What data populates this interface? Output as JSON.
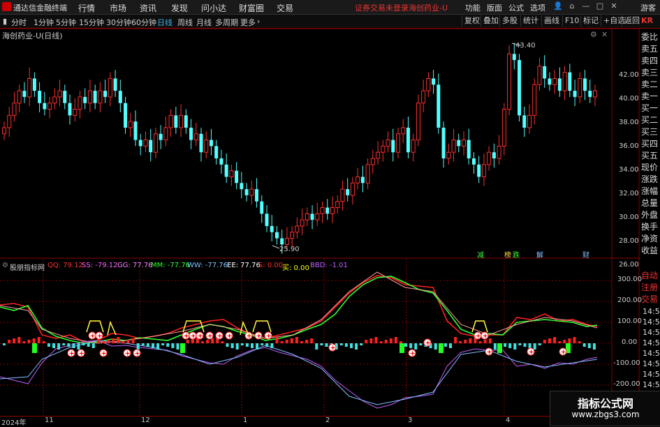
{
  "app": {
    "title": "通达信金融终端"
  },
  "menu": [
    "行情",
    "市场",
    "资讯",
    "发现",
    "问小达",
    "财富圈",
    "交易"
  ],
  "warning": "证券交易未登录",
  "stock_label": "海创药业-U",
  "right_menu": [
    "功能",
    "版面",
    "公式",
    "选项"
  ],
  "guest": "游客",
  "toolbar": {
    "periods": [
      "分时",
      "1分钟",
      "5分钟",
      "15分钟",
      "30分钟",
      "60分钟",
      "日线",
      "周线",
      "月线",
      "多周期",
      "更多"
    ],
    "active": "日线",
    "right": [
      "复权",
      "叠加",
      "多股",
      "统计",
      "画线",
      "F10",
      "标记",
      "+自选",
      "返回"
    ]
  },
  "chart_title": "海创药业-U(日线)",
  "kr_badge": "KR",
  "side_panel": [
    "委比",
    "卖五",
    "卖四",
    "卖三",
    "卖二",
    "卖一",
    "买一",
    "买二",
    "买三",
    "买四",
    "买五",
    "现价",
    "涨跌",
    "涨幅",
    "总量",
    "外盘",
    "换手",
    "净资",
    "收益"
  ],
  "side_panel2": [
    "自动",
    "注册",
    "交易"
  ],
  "price_axis": [
    "42.00",
    "40.00",
    "38.00",
    "36.00",
    "34.00",
    "32.00",
    "30.00",
    "28.00",
    "26.00"
  ],
  "annotations": {
    "high": "43.40",
    "low": "25.90"
  },
  "tags": [
    "减",
    "榜",
    "跌",
    "解",
    "财"
  ],
  "indicator": {
    "name": "股朋指标网",
    "values": [
      {
        "label": "QQ: 79.12",
        "color": "#ff3030"
      },
      {
        "label": "SS: -79.12",
        "color": "#ff60ff"
      },
      {
        "label": "GG: 77.76",
        "color": "#ff80ff"
      },
      {
        "label": "MM: -77.76",
        "color": "#30ff30"
      },
      {
        "label": "WW: -77.76",
        "color": "#80c0ff"
      },
      {
        "label": "EE: 77.76",
        "color": "#ffffff"
      },
      {
        "label": "S: 0.00",
        "color": "#ff3030"
      },
      {
        "label": "买: 0.00",
        "color": "#ffff00"
      },
      {
        "label": "BBD: -1.01",
        "color": "#c060ff"
      }
    ],
    "axis": [
      "300.00",
      "200.00",
      "100.00",
      "0.00",
      "-100.00",
      "-200.00"
    ],
    "right_times": [
      "14:56",
      "14:56",
      "14:56",
      "14:56",
      "14:56",
      "14:56",
      "14:56",
      "14:56"
    ]
  },
  "x_axis": [
    "2024年",
    "11",
    "12",
    "1",
    "2",
    "3",
    "4"
  ],
  "watermark": {
    "line1": "指标公式网",
    "line2": "www.zbgs3.com"
  },
  "colors": {
    "up": "#ff3030",
    "down": "#54ffff",
    "grid": "#8b0000"
  },
  "chart_data": {
    "type": "candlestick",
    "title": "海创药业-U(日线)",
    "ylim": [
      25.5,
      44
    ],
    "series": [
      {
        "name": "price",
        "values": [
          36,
          37,
          38,
          39,
          38.5,
          40,
          39,
          38,
          37.5,
          38,
          38.5,
          39,
          38,
          37,
          37.5,
          38.5,
          38,
          39,
          38,
          39,
          38.5,
          40,
          39,
          38,
          36,
          36.5,
          35,
          34.5,
          35,
          34,
          35.5,
          35,
          36,
          37,
          36,
          37,
          36,
          35,
          35.5,
          34,
          35,
          34.5,
          33.5,
          33,
          32,
          32.5,
          31.5,
          31,
          30.5,
          31,
          30,
          29,
          28,
          27.5,
          27,
          26.5,
          27,
          27.5,
          28,
          28.5,
          29,
          28.5,
          29,
          29.5,
          29,
          29.5,
          30,
          31,
          30.5,
          31.5,
          32,
          31.5,
          33,
          33.5,
          34,
          34.5,
          35,
          34,
          35.5,
          36,
          34,
          35,
          38,
          39,
          40,
          39.5,
          36,
          33.5,
          34,
          35,
          34.5,
          35,
          33.5,
          33,
          32,
          33,
          34,
          33.5,
          34.5,
          37.5,
          42,
          41.5,
          37,
          36,
          37,
          39.5,
          41,
          40,
          39.5,
          40,
          39,
          40.5,
          39,
          38.5,
          40,
          39,
          38.5,
          39
        ]
      }
    ]
  }
}
